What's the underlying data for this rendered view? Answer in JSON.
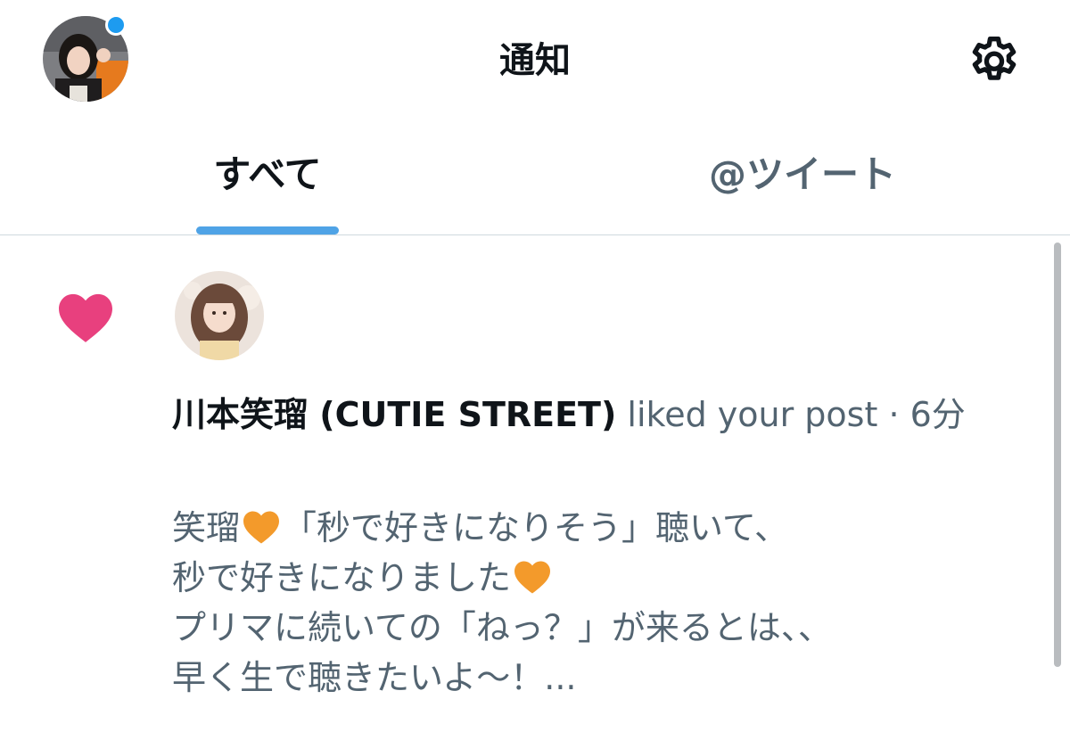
{
  "header": {
    "title": "通知",
    "avatar_icon": "user-avatar",
    "settings_icon": "gear-icon",
    "unread_dot_color": "#1d9bf0"
  },
  "tabs": [
    {
      "label": "すべて",
      "active": true
    },
    {
      "label": "@ツイート",
      "active": false
    }
  ],
  "accent_color": "#4fa3e6",
  "notification": {
    "type_icon": "heart-icon",
    "type_color": "#e8407e",
    "user_name": "川本笑瑠 (CUTIE STREET)",
    "action_text": " liked your post · 6分",
    "body_lines": [
      {
        "before": "笑瑠",
        "heart": true,
        "after": "「秒で好きになりそう」聴いて、"
      },
      {
        "before": "秒で好きになりました",
        "heart": true,
        "after": ""
      },
      {
        "before": "プリマに続いての「ねっ？」が来るとは、、",
        "heart": false,
        "after": ""
      },
      {
        "before": "早く生で聴きたいよ〜！...",
        "heart": false,
        "after": ""
      }
    ],
    "emoji_color": "#f39a2b"
  }
}
